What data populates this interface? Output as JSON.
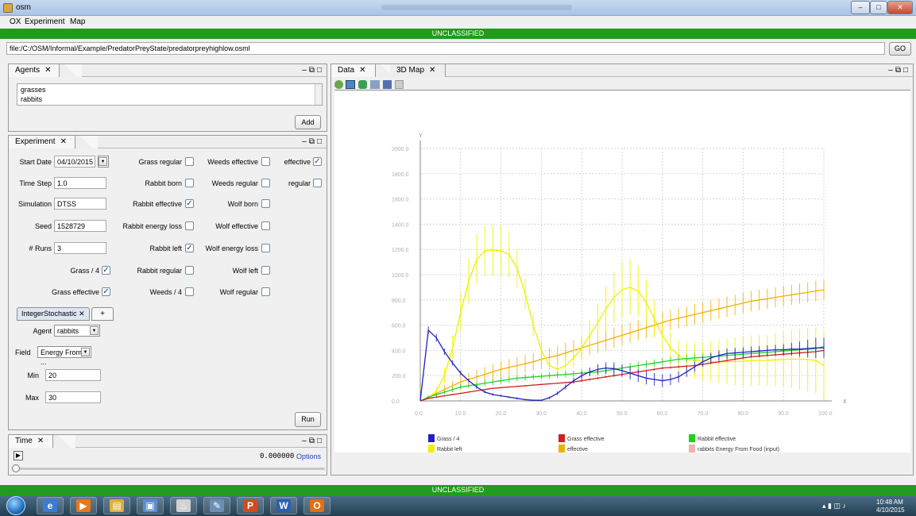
{
  "window": {
    "title": "osm",
    "controls": [
      "–",
      "□",
      "✕"
    ]
  },
  "menu": [
    "OX",
    "Experiment",
    "Map"
  ],
  "classification": "UNCLASSIFIED",
  "url": {
    "value": "file:/C:/OSM/Informal/Example/PredatorPreyState/predatorpreyhighlow.osml",
    "go_label": "GO"
  },
  "agents_panel": {
    "tab": "Agents",
    "items": [
      "grasses",
      "rabbits"
    ],
    "add_label": "Add"
  },
  "experiment_panel": {
    "tab": "Experiment",
    "start_date": {
      "label": "Start Date",
      "value": "04/10/2015"
    },
    "time_step": {
      "label": "Time Step",
      "value": "1.0"
    },
    "simulation": {
      "label": "Simulation",
      "value": "DTSS"
    },
    "seed": {
      "label": "Seed",
      "value": "1528729"
    },
    "runs": {
      "label": "# Runs",
      "value": "3"
    },
    "checks": [
      {
        "label": "Grass / 4",
        "checked": true
      },
      {
        "label": "Grass effective",
        "checked": true
      },
      {
        "label": "Grass regular",
        "checked": false
      },
      {
        "label": "Rabbit born",
        "checked": false
      },
      {
        "label": "Rabbit effective",
        "checked": true
      },
      {
        "label": "Rabbit energy loss",
        "checked": false
      },
      {
        "label": "Rabbit left",
        "checked": true
      },
      {
        "label": "Rabbit regular",
        "checked": false
      },
      {
        "label": "Weeds / 4",
        "checked": false
      },
      {
        "label": "Weeds effective",
        "checked": false
      },
      {
        "label": "Weeds regular",
        "checked": false
      },
      {
        "label": "Wolf born",
        "checked": false
      },
      {
        "label": "Wolf effective",
        "checked": false
      },
      {
        "label": "Wolf energy loss",
        "checked": false
      },
      {
        "label": "Wolf left",
        "checked": false
      },
      {
        "label": "Wolf regular",
        "checked": false
      },
      {
        "label": "effective",
        "checked": true
      },
      {
        "label": "regular",
        "checked": false
      }
    ],
    "stochastic_tab": "IntegerStochastic",
    "add_tab": "+",
    "agent": {
      "label": "Agent",
      "value": "rabbits"
    },
    "field": {
      "label": "Field",
      "value": "Energy From ..."
    },
    "min": {
      "label": "Min",
      "value": "20"
    },
    "max": {
      "label": "Max",
      "value": "30"
    },
    "run_label": "Run"
  },
  "time_panel": {
    "tab": "Time",
    "time_value": "0.000000",
    "options_label": "Options"
  },
  "data_panel": {
    "tabs": [
      "Data",
      "3D Map"
    ],
    "toolbar_icons": [
      "zoom-fit-icon",
      "zoom-icon",
      "pan-icon",
      "layers-icon",
      "save-chart-icon",
      "table-icon"
    ]
  },
  "chart_data": {
    "type": "line",
    "xlabel": "X",
    "ylabel": "Y",
    "xlim": [
      0,
      100
    ],
    "ylim": [
      0,
      2000
    ],
    "xticks": [
      "0.0",
      "10.0",
      "20.0",
      "30.0",
      "40.0",
      "50.0",
      "60.0",
      "70.0",
      "80.0",
      "90.0",
      "100.0"
    ],
    "yticks": [
      "0.0",
      "200.0",
      "400.0",
      "600.0",
      "800.0",
      "1000.0",
      "1200.0",
      "1400.0",
      "1600.0",
      "1800.0",
      "2000.0"
    ],
    "grid": true,
    "legend_position": "bottom",
    "error_bars": true,
    "x": [
      0,
      2,
      4,
      6,
      8,
      10,
      12,
      14,
      16,
      18,
      20,
      22,
      24,
      26,
      28,
      30,
      32,
      34,
      36,
      38,
      40,
      42,
      44,
      46,
      48,
      50,
      52,
      54,
      56,
      58,
      60,
      62,
      64,
      66,
      68,
      70,
      72,
      74,
      76,
      78,
      80,
      82,
      84,
      86,
      88,
      90,
      92,
      94,
      96,
      98,
      100
    ],
    "series": [
      {
        "name": "Grass / 4",
        "color": "#2020c0",
        "values": [
          0,
          560,
          500,
          390,
          300,
          220,
          160,
          110,
          70,
          50,
          40,
          30,
          20,
          10,
          5,
          5,
          25,
          60,
          110,
          160,
          200,
          230,
          250,
          260,
          255,
          240,
          220,
          200,
          180,
          170,
          160,
          170,
          190,
          230,
          270,
          310,
          340,
          360,
          375,
          380,
          385,
          390,
          395,
          400,
          405,
          405,
          410,
          410,
          415,
          420,
          420
        ],
        "err": [
          0,
          30,
          30,
          25,
          20,
          20,
          15,
          15,
          10,
          10,
          8,
          8,
          8,
          6,
          5,
          5,
          10,
          15,
          20,
          25,
          30,
          35,
          40,
          45,
          50,
          50,
          50,
          50,
          50,
          50,
          50,
          45,
          45,
          40,
          40,
          40,
          40,
          40,
          40,
          40,
          40,
          40,
          40,
          40,
          40,
          45,
          50,
          60,
          70,
          80,
          80
        ]
      },
      {
        "name": "Grass effective",
        "color": "#d02020",
        "values": [
          0,
          20,
          30,
          40,
          50,
          60,
          70,
          80,
          90,
          100,
          105,
          110,
          115,
          120,
          125,
          130,
          135,
          140,
          145,
          150,
          160,
          170,
          180,
          190,
          200,
          210,
          220,
          230,
          240,
          250,
          260,
          265,
          270,
          275,
          280,
          290,
          300,
          310,
          320,
          330,
          340,
          350,
          355,
          360,
          365,
          370,
          375,
          380,
          385,
          390,
          400
        ],
        "err": [
          0,
          5,
          5,
          5,
          5,
          5,
          5,
          5,
          5,
          5,
          5,
          5,
          5,
          5,
          5,
          5,
          5,
          5,
          5,
          5,
          10,
          10,
          10,
          10,
          10,
          10,
          10,
          10,
          10,
          10,
          10,
          10,
          10,
          10,
          10,
          10,
          10,
          10,
          10,
          10,
          10,
          10,
          10,
          10,
          10,
          10,
          10,
          10,
          10,
          10,
          10
        ]
      },
      {
        "name": "Rabbit effective",
        "color": "#20d020",
        "values": [
          0,
          30,
          50,
          70,
          90,
          110,
          120,
          130,
          140,
          150,
          160,
          170,
          180,
          185,
          190,
          195,
          200,
          205,
          210,
          215,
          220,
          225,
          230,
          240,
          250,
          260,
          270,
          280,
          290,
          300,
          310,
          320,
          330,
          335,
          340,
          345,
          350,
          355,
          360,
          365,
          370,
          375,
          380,
          385,
          390,
          395,
          400,
          405,
          410,
          415,
          430
        ],
        "err": [
          0,
          10,
          15,
          15,
          20,
          20,
          20,
          20,
          25,
          25,
          25,
          25,
          25,
          25,
          25,
          25,
          25,
          25,
          25,
          25,
          30,
          30,
          30,
          30,
          30,
          30,
          30,
          30,
          30,
          30,
          30,
          30,
          30,
          30,
          30,
          30,
          30,
          30,
          30,
          30,
          30,
          30,
          30,
          30,
          30,
          30,
          30,
          30,
          30,
          30,
          30
        ]
      },
      {
        "name": "Rabbit left",
        "color": "#f0f000",
        "values": [
          0,
          20,
          80,
          200,
          420,
          700,
          950,
          1120,
          1190,
          1195,
          1190,
          1160,
          1050,
          850,
          600,
          400,
          280,
          250,
          280,
          340,
          420,
          520,
          620,
          730,
          820,
          880,
          900,
          870,
          780,
          650,
          520,
          420,
          360,
          330,
          320,
          315,
          312,
          310,
          310,
          312,
          315,
          318,
          320,
          322,
          325,
          328,
          330,
          330,
          328,
          320,
          280
        ],
        "err": [
          0,
          10,
          30,
          60,
          100,
          150,
          180,
          200,
          200,
          200,
          200,
          180,
          150,
          120,
          90,
          70,
          60,
          60,
          70,
          80,
          100,
          120,
          150,
          180,
          200,
          220,
          220,
          200,
          180,
          150,
          130,
          120,
          120,
          130,
          140,
          150,
          160,
          170,
          180,
          190,
          200,
          200,
          200,
          200,
          210,
          220,
          230,
          240,
          250,
          260,
          270
        ]
      },
      {
        "name": "effective",
        "color": "#f0b000",
        "values": [
          0,
          30,
          60,
          90,
          120,
          150,
          170,
          190,
          210,
          230,
          250,
          265,
          280,
          295,
          310,
          330,
          345,
          360,
          380,
          400,
          420,
          440,
          460,
          480,
          500,
          520,
          540,
          560,
          580,
          600,
          620,
          640,
          655,
          670,
          685,
          700,
          715,
          730,
          745,
          760,
          775,
          790,
          800,
          810,
          820,
          830,
          840,
          850,
          860,
          870,
          880
        ],
        "err": [
          0,
          15,
          25,
          35,
          40,
          45,
          50,
          55,
          60,
          60,
          65,
          65,
          70,
          70,
          70,
          75,
          75,
          75,
          80,
          80,
          80,
          80,
          80,
          80,
          80,
          80,
          80,
          80,
          80,
          80,
          80,
          80,
          80,
          80,
          80,
          80,
          80,
          80,
          80,
          80,
          80,
          80,
          80,
          80,
          80,
          80,
          80,
          80,
          80,
          80,
          80
        ]
      },
      {
        "name": "rabbits Energy From Food (input)",
        "color": "#f4b0b0",
        "values": [],
        "err": []
      }
    ]
  },
  "taskbar": {
    "apps": [
      {
        "name": "ie-icon",
        "glyph": "e"
      },
      {
        "name": "media-player-icon",
        "glyph": "▶"
      },
      {
        "name": "file-explorer-icon",
        "glyph": "▤"
      },
      {
        "name": "virtualbox-icon",
        "glyph": "▣"
      },
      {
        "name": "java-icon",
        "glyph": "♨"
      },
      {
        "name": "paint-icon",
        "glyph": "✎"
      },
      {
        "name": "powerpoint-icon",
        "glyph": "P"
      },
      {
        "name": "word-icon",
        "glyph": "W"
      },
      {
        "name": "outlook-icon",
        "glyph": "O"
      }
    ],
    "time": "10:48 AM",
    "date": "4/10/2015"
  }
}
